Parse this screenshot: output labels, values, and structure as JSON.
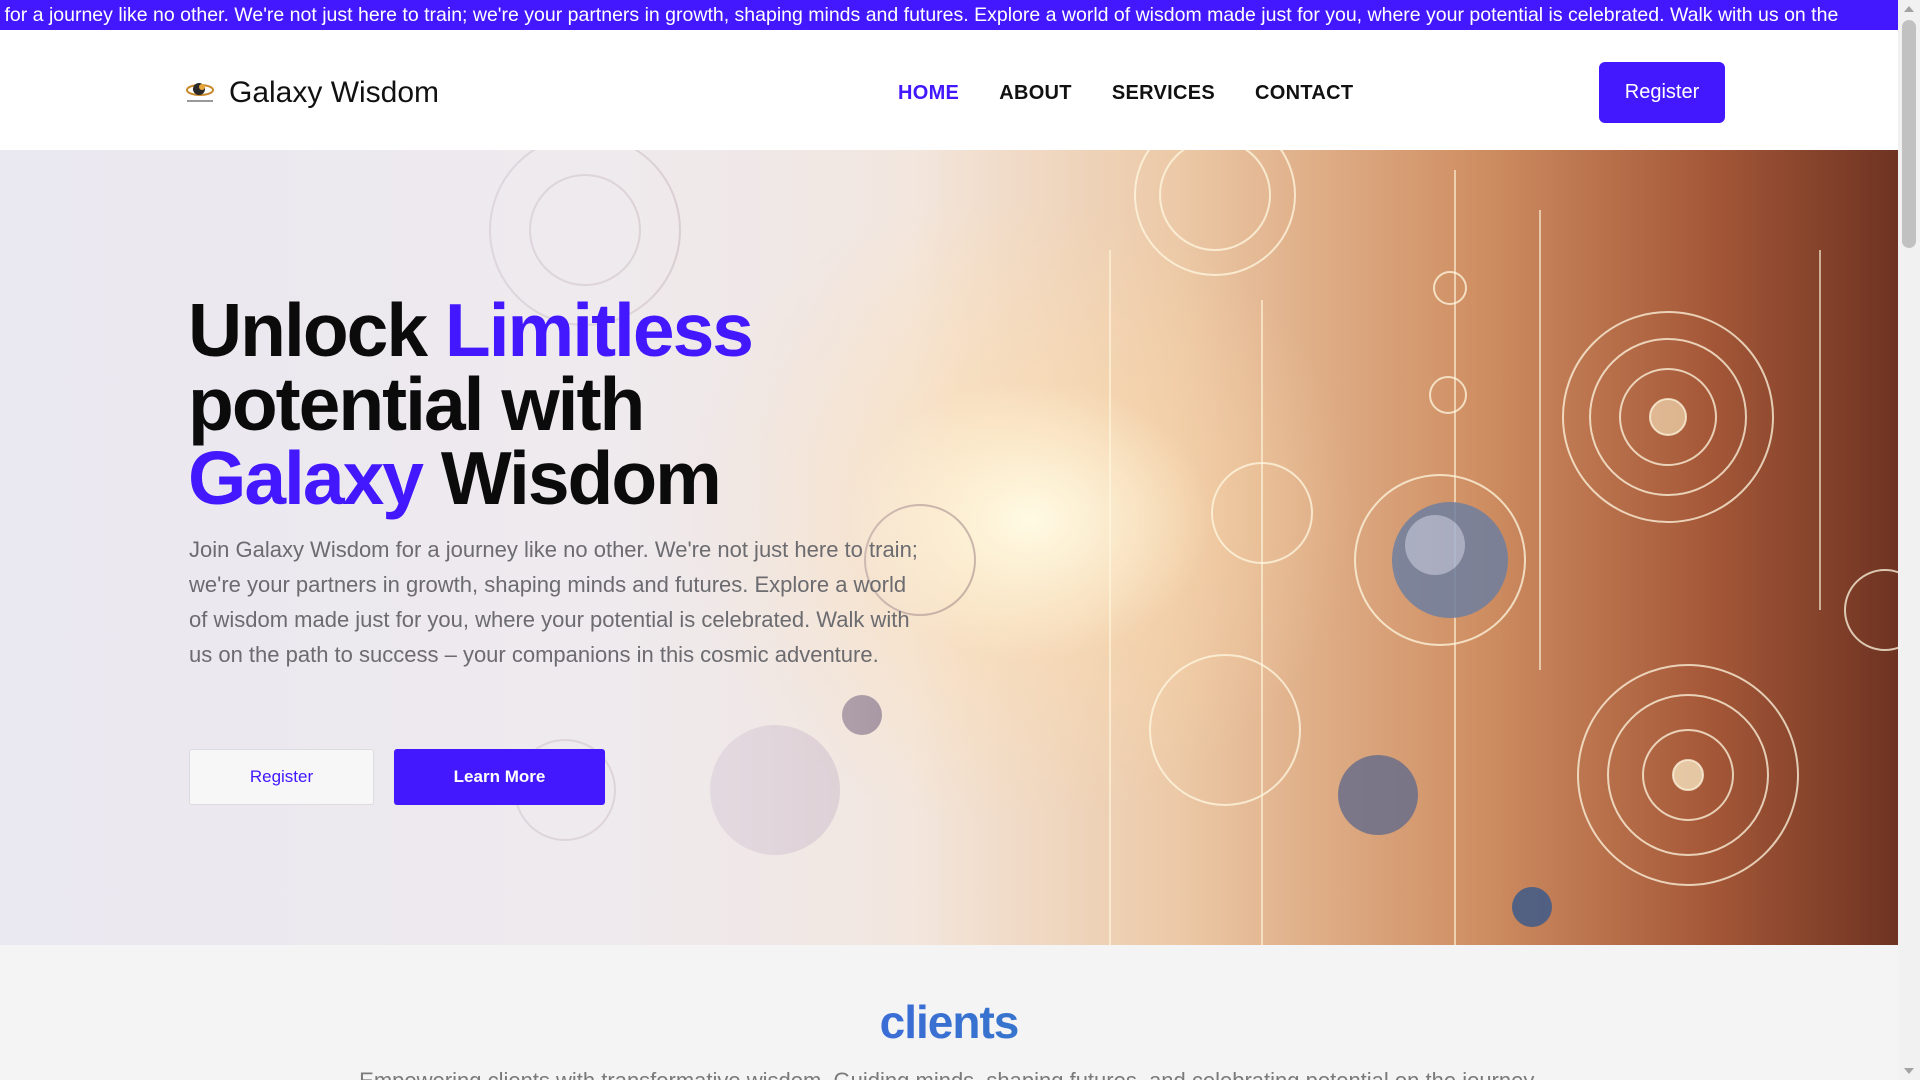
{
  "marquee": {
    "text": "om for a journey like no other. We're not just here to train; we're your partners in growth, shaping minds and futures. Explore a world of wisdom made just for you, where your potential is celebrated. Walk with us on the"
  },
  "header": {
    "logo_icon": "galaxy-logo-icon",
    "brand": "Galaxy Wisdom",
    "nav": [
      {
        "label": "HOME",
        "active": true
      },
      {
        "label": "ABOUT",
        "active": false
      },
      {
        "label": "SERVICES",
        "active": false
      },
      {
        "label": "CONTACT",
        "active": false
      }
    ],
    "register_label": "Register"
  },
  "hero": {
    "title_1": "Unlock ",
    "title_accent_1": "Limitless",
    "title_2": "potential with",
    "title_accent_2": "Galaxy",
    "title_3": " Wisdom",
    "lead": "Join Galaxy Wisdom for a journey like no other. We're not just here to train; we're your partners in growth, shaping minds and futures. Explore a world of wisdom made just for you, where your potential is celebrated. Walk with us on the path to success – your companions in this cosmic adventure.",
    "register_label": "Register",
    "learn_more_label": "Learn More"
  },
  "clients": {
    "title": "clients",
    "subtitle": "Empowering clients with transformative wisdom. Guiding minds, shaping futures, and celebrating potential on the journey."
  },
  "colors": {
    "accent": "#4318ff",
    "text": "#0b0b0b",
    "muted": "#6b6b70",
    "clients_gradient_end": "#1fa88f"
  }
}
